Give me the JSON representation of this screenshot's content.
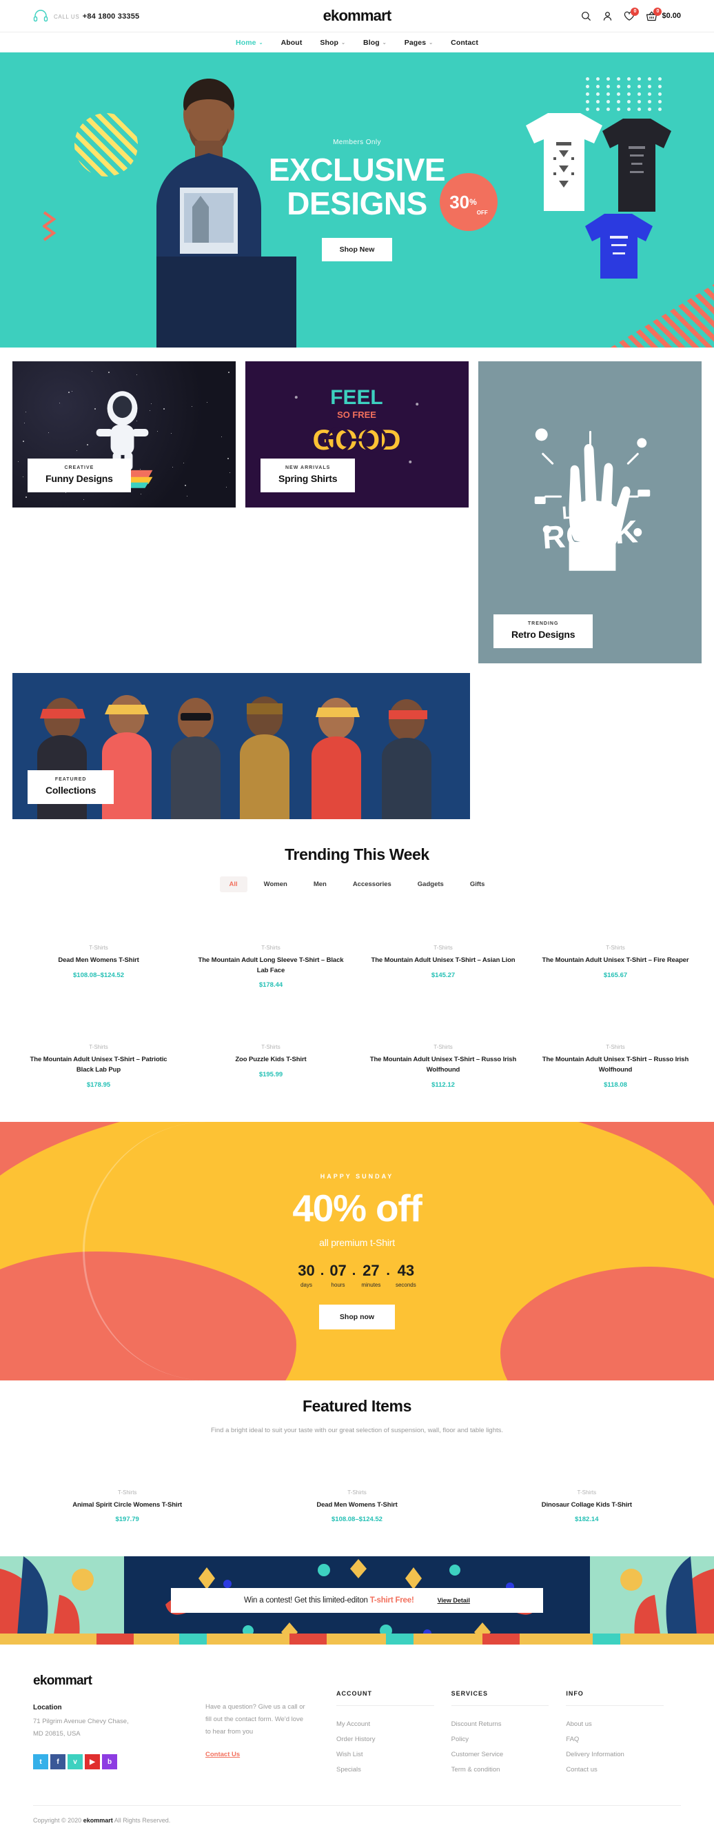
{
  "header": {
    "call_label": "CALL US",
    "phone": "+84 1800 33355",
    "brand": "ekommart",
    "icons": {
      "search": "search-icon",
      "account": "user-icon",
      "wishlist": "heart-icon",
      "cart": "basket-icon"
    },
    "wishlist_count": "0",
    "cart_count": "0",
    "cart_total": "$0.00"
  },
  "nav": {
    "items": [
      {
        "label": "Home",
        "caret": "⌄",
        "active": true
      },
      {
        "label": "About",
        "caret": "",
        "active": false
      },
      {
        "label": "Shop",
        "caret": "⌄",
        "active": false
      },
      {
        "label": "Blog",
        "caret": "⌄",
        "active": false
      },
      {
        "label": "Pages",
        "caret": "⌄",
        "active": false
      },
      {
        "label": "Contact",
        "caret": "",
        "active": false
      }
    ]
  },
  "hero": {
    "eyebrow": "Members Only",
    "title_line1": "EXCLUSIVE",
    "title_line2": "DESIGNS",
    "button": "Shop New",
    "badge_number": "30",
    "badge_percent": "%",
    "badge_off": "OFF",
    "bg_color": "#3dcfbe",
    "badge_color": "#f2705d"
  },
  "categories": [
    {
      "sub": "CREATIVE",
      "name": "Funny Designs"
    },
    {
      "sub": "NEW ARRIVALS",
      "name": "Spring Shirts"
    },
    {
      "sub": "TRENDING",
      "name": "Retro Designs"
    },
    {
      "sub": "FEATURED",
      "name": "Collections"
    }
  ],
  "retro_art": {
    "line1": "LET'S",
    "line2": "ROCK"
  },
  "trending": {
    "title": "Trending This Week",
    "tabs": [
      {
        "label": "All",
        "active": true
      },
      {
        "label": "Women",
        "active": false
      },
      {
        "label": "Men",
        "active": false
      },
      {
        "label": "Accessories",
        "active": false
      },
      {
        "label": "Gadgets",
        "active": false
      },
      {
        "label": "Gifts",
        "active": false
      }
    ],
    "products": [
      {
        "cat": "T-Shirts",
        "name": "Dead Men Womens T-Shirt",
        "price": "$108.08–$124.52"
      },
      {
        "cat": "T-Shirts",
        "name": "The Mountain Adult Long Sleeve T-Shirt – Black Lab Face",
        "price": "$178.44"
      },
      {
        "cat": "T-Shirts",
        "name": "The Mountain Adult Unisex T-Shirt – Asian Lion",
        "price": "$145.27"
      },
      {
        "cat": "T-Shirts",
        "name": "The Mountain Adult Unisex T-Shirt – Fire Reaper",
        "price": "$165.67"
      },
      {
        "cat": "T-Shirts",
        "name": "The Mountain Adult Unisex T-Shirt – Patriotic Black Lab Pup",
        "price": "$178.95"
      },
      {
        "cat": "T-Shirts",
        "name": "Zoo Puzzle Kids T-Shirt",
        "price": "$195.99"
      },
      {
        "cat": "T-Shirts",
        "name": "The Mountain Adult Unisex T-Shirt – Russo Irish Wolfhound",
        "price": "$112.12"
      },
      {
        "cat": "T-Shirts",
        "name": "The Mountain Adult Unisex T-Shirt – Russo Irish Wolfhound",
        "price": "$118.08"
      }
    ]
  },
  "promo": {
    "eyebrow": "HAPPY SUNDAY",
    "headline": "40% off",
    "subline": "all premium t-Shirt",
    "countdown": [
      {
        "value": "30",
        "label": "days"
      },
      {
        "value": "07",
        "label": "hours"
      },
      {
        "value": "27",
        "label": "minutes"
      },
      {
        "value": "43",
        "label": "seconds"
      }
    ],
    "separator": ".",
    "button": "Shop now",
    "bg_color": "#f2705d",
    "blob_color": "#fdc234"
  },
  "featured": {
    "title": "Featured Items",
    "subtitle": "Find a bright ideal to suit your taste with our great selection of suspension, wall, floor and table lights.",
    "products": [
      {
        "cat": "T-Shirts",
        "name": "Animal Spirit Circle Womens T-Shirt",
        "price": "$197.79"
      },
      {
        "cat": "T-Shirts",
        "name": "Dead Men Womens T-Shirt",
        "price": "$108.08–$124.52"
      },
      {
        "cat": "T-Shirts",
        "name": "Dinosaur Collage Kids T-Shirt",
        "price": "$182.14"
      }
    ]
  },
  "contest": {
    "text_plain": "Win a contest! Get this limited-editon ",
    "text_highlight": "T-shirt Free!",
    "link": "View Detail",
    "highlight_color": "#f2705d"
  },
  "footer": {
    "brand": "ekommart",
    "location_title": "Location",
    "location_line1": "71 Pilgrim Avenue Chevy Chase,",
    "location_line2": "MD 20815, USA",
    "socials": [
      {
        "name": "twitter",
        "glyph": "t",
        "color": "#35b0e9"
      },
      {
        "name": "facebook",
        "glyph": "f",
        "color": "#3a5897"
      },
      {
        "name": "vimeo",
        "glyph": "v",
        "color": "#3dd1c0"
      },
      {
        "name": "youtube",
        "glyph": "▶",
        "color": "#e02f2f"
      },
      {
        "name": "behance",
        "glyph": "b",
        "color": "#8d3ce2"
      }
    ],
    "contact_text_line1": "Have a question? Give us a call or",
    "contact_text_line2": "fill out the contact form. We'd love",
    "contact_text_line3": "to hear from you",
    "contact_link": "Contact Us",
    "columns": [
      {
        "head": "ACCOUNT",
        "links": [
          "My Account",
          "Order History",
          "Wish List",
          "Specials"
        ]
      },
      {
        "head": "SERVICES",
        "links": [
          "Discount Returns",
          "Policy",
          "Customer Service",
          "Term & condition"
        ]
      },
      {
        "head": "INFO",
        "links": [
          "About us",
          "FAQ",
          "Delivery Information",
          "Contact us"
        ]
      }
    ],
    "copyright_pre": "Copyright © 2020 ",
    "copyright_brand": "ekommart",
    "copyright_post": " All Rights Reserved."
  }
}
